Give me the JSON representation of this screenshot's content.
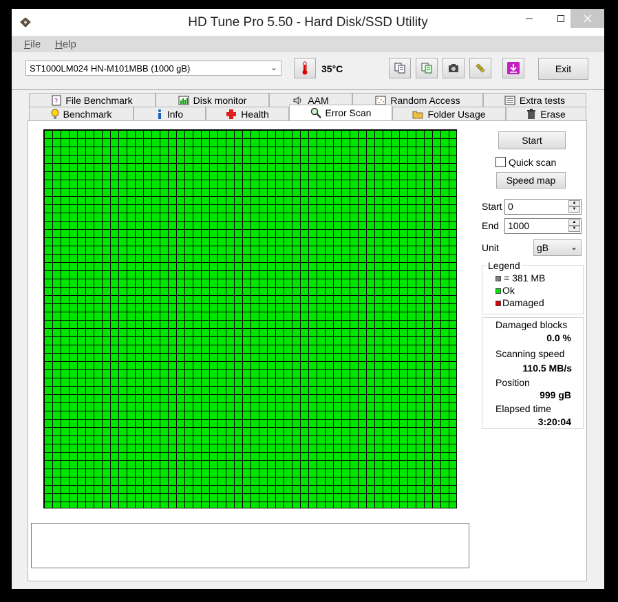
{
  "window": {
    "title": "HD Tune Pro 5.50 - Hard Disk/SSD Utility"
  },
  "menu": [
    {
      "label": "File",
      "underline": "F",
      "rest": "ile"
    },
    {
      "label": "Help",
      "underline": "H",
      "rest": "elp"
    }
  ],
  "toolbar": {
    "drive": "ST1000LM024 HN-M101MBB (1000 gB)",
    "temperature": "35°C",
    "exit_label": "Exit"
  },
  "tabs_top": [
    "File Benchmark",
    "Disk monitor",
    "AAM",
    "Random Access",
    "Extra tests"
  ],
  "tabs_bottom": [
    "Benchmark",
    "Info",
    "Health",
    "Error Scan",
    "Folder Usage",
    "Erase"
  ],
  "active_tab": "Error Scan",
  "controls": {
    "start_button": "Start",
    "quick_scan_label": "Quick scan",
    "quick_scan_checked": false,
    "speed_map_button": "Speed map",
    "start_label": "Start",
    "start_value": "0",
    "end_label": "End",
    "end_value": "1000",
    "unit_label": "Unit",
    "unit_value": "gB"
  },
  "legend": {
    "title": "Legend",
    "items": [
      {
        "label": "= 381 MB",
        "color": "#808080"
      },
      {
        "label": "Ok",
        "color": "#00e600"
      },
      {
        "label": "Damaged",
        "color": "#e00000"
      }
    ]
  },
  "stats": {
    "damaged_blocks_label": "Damaged blocks",
    "damaged_blocks_value": "0.0 %",
    "scanning_speed_label": "Scanning speed",
    "scanning_speed_value": "110.5 MB/s",
    "position_label": "Position",
    "position_value": "999 gB",
    "elapsed_label": "Elapsed time",
    "elapsed_value": "3:20:04"
  },
  "scan_grid": {
    "columns": 50,
    "rows": 46,
    "block_status": "ok",
    "color": "#00e600"
  },
  "colors": {
    "ok": "#00e600",
    "damaged": "#e00000",
    "block": "#808080"
  }
}
